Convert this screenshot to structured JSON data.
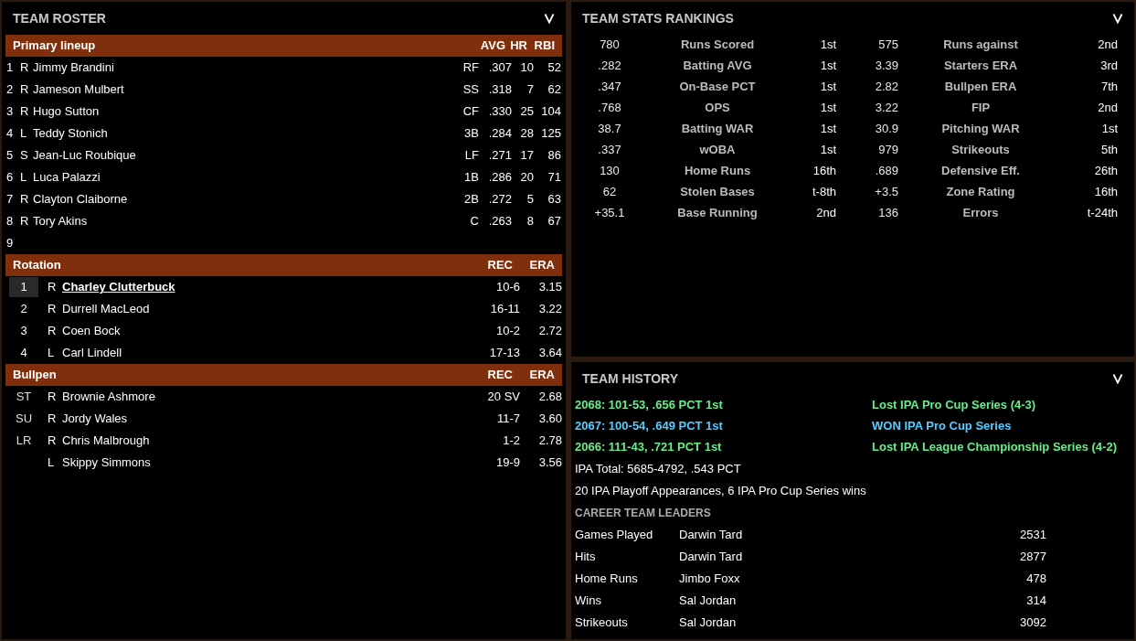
{
  "roster": {
    "title": "TEAM ROSTER",
    "lineup": {
      "heading": "Primary lineup",
      "columns": [
        "AVG",
        "HR",
        "RBI"
      ],
      "rows": [
        {
          "order": "1",
          "hand": "R",
          "name": "Jimmy Brandini",
          "pos": "RF",
          "avg": ".307",
          "hr": "10",
          "rbi": "52"
        },
        {
          "order": "2",
          "hand": "R",
          "name": "Jameson Mulbert",
          "pos": "SS",
          "avg": ".318",
          "hr": "7",
          "rbi": "62"
        },
        {
          "order": "3",
          "hand": "R",
          "name": "Hugo Sutton",
          "pos": "CF",
          "avg": ".330",
          "hr": "25",
          "rbi": "104"
        },
        {
          "order": "4",
          "hand": "L",
          "name": "Teddy Stonich",
          "pos": "3B",
          "avg": ".284",
          "hr": "28",
          "rbi": "125"
        },
        {
          "order": "5",
          "hand": "S",
          "name": "Jean-Luc Roubique",
          "pos": "LF",
          "avg": ".271",
          "hr": "17",
          "rbi": "86"
        },
        {
          "order": "6",
          "hand": "L",
          "name": "Luca Palazzi",
          "pos": "1B",
          "avg": ".286",
          "hr": "20",
          "rbi": "71"
        },
        {
          "order": "7",
          "hand": "R",
          "name": "Clayton Claiborne",
          "pos": "2B",
          "avg": ".272",
          "hr": "5",
          "rbi": "63"
        },
        {
          "order": "8",
          "hand": "R",
          "name": "Tory Akins",
          "pos": "C",
          "avg": ".263",
          "hr": "8",
          "rbi": "67"
        },
        {
          "order": "9"
        }
      ]
    },
    "rotation": {
      "heading": "Rotation",
      "columns": [
        "REC",
        "ERA"
      ],
      "rows": [
        {
          "slot": "1",
          "hand": "R",
          "name": "Charley Clutterbuck",
          "rec": "10-6",
          "era": "3.15",
          "selected": true
        },
        {
          "slot": "2",
          "hand": "R",
          "name": "Durrell MacLeod",
          "rec": "16-11",
          "era": "3.22",
          "selected": false
        },
        {
          "slot": "3",
          "hand": "R",
          "name": "Coen Bock",
          "rec": "10-2",
          "era": "2.72",
          "selected": false
        },
        {
          "slot": "4",
          "hand": "L",
          "name": "Carl Lindell",
          "rec": "17-13",
          "era": "3.64",
          "selected": false
        }
      ]
    },
    "bullpen": {
      "heading": "Bullpen",
      "columns": [
        "REC",
        "ERA"
      ],
      "rows": [
        {
          "slot": "ST",
          "hand": "R",
          "name": "Brownie Ashmore",
          "rec": "20 SV",
          "era": "2.68"
        },
        {
          "slot": "SU",
          "hand": "R",
          "name": "Jordy Wales",
          "rec": "11-7",
          "era": "3.60"
        },
        {
          "slot": "LR",
          "hand": "R",
          "name": "Chris Malbrough",
          "rec": "1-2",
          "era": "2.78"
        },
        {
          "hand": "L",
          "name": "Skippy Simmons",
          "rec": "19-9",
          "era": "3.56"
        }
      ]
    }
  },
  "rankings": {
    "title": "TEAM STATS RANKINGS",
    "rows": [
      {
        "batting": {
          "value": "780",
          "label": "Runs Scored",
          "rank": "1st"
        },
        "pitching": {
          "value": "575",
          "label": "Runs against",
          "rank": "2nd"
        }
      },
      {
        "batting": {
          "value": ".282",
          "label": "Batting AVG",
          "rank": "1st"
        },
        "pitching": {
          "value": "3.39",
          "label": "Starters ERA",
          "rank": "3rd"
        }
      },
      {
        "batting": {
          "value": ".347",
          "label": "On-Base PCT",
          "rank": "1st"
        },
        "pitching": {
          "value": "2.82",
          "label": "Bullpen ERA",
          "rank": "7th"
        }
      },
      {
        "batting": {
          "value": ".768",
          "label": "OPS",
          "rank": "1st"
        },
        "pitching": {
          "value": "3.22",
          "label": "FIP",
          "rank": "2nd"
        }
      },
      {
        "batting": {
          "value": "38.7",
          "label": "Batting WAR",
          "rank": "1st"
        },
        "pitching": {
          "value": "30.9",
          "label": "Pitching WAR",
          "rank": "1st"
        }
      },
      {
        "batting": {
          "value": ".337",
          "label": "wOBA",
          "rank": "1st"
        },
        "pitching": {
          "value": "979",
          "label": "Strikeouts",
          "rank": "5th"
        }
      },
      {
        "batting": {
          "value": "130",
          "label": "Home Runs",
          "rank": "16th"
        },
        "pitching": {
          "value": ".689",
          "label": "Defensive Eff.",
          "rank": "26th"
        }
      },
      {
        "batting": {
          "value": "62",
          "label": "Stolen Bases",
          "rank": "t-8th"
        },
        "pitching": {
          "value": "+3.5",
          "label": "Zone Rating",
          "rank": "16th"
        }
      },
      {
        "batting": {
          "value": "+35.1",
          "label": "Base Running",
          "rank": "2nd"
        },
        "pitching": {
          "value": "136",
          "label": "Errors",
          "rank": "t-24th"
        }
      }
    ]
  },
  "history": {
    "title": "TEAM HISTORY",
    "seasons": [
      {
        "record": "2068: 101-53, .656 PCT 1st",
        "result": "Lost IPA Pro Cup Series (4-3)",
        "color": "#66ee88"
      },
      {
        "record": "2067: 100-54, .649 PCT 1st",
        "result": "WON IPA Pro Cup Series",
        "color": "#55ccff"
      },
      {
        "record": "2066: 111-43, .721 PCT 1st",
        "result": "Lost IPA League Championship Series  (4-2)",
        "color": "#66ee88"
      }
    ],
    "total": "IPA Total: 5685-4792, .543 PCT",
    "playoffs": "20 IPA Playoff Appearances, 6 IPA Pro Cup Series wins",
    "leaders_title": "CAREER TEAM LEADERS",
    "leaders": [
      {
        "category": "Games Played",
        "player": "Darwin Tard",
        "value": "2531"
      },
      {
        "category": "Hits",
        "player": "Darwin Tard",
        "value": "2877"
      },
      {
        "category": "Home Runs",
        "player": "Jimbo Foxx",
        "value": "478"
      },
      {
        "category": "Wins",
        "player": "Sal Jordan",
        "value": "314"
      },
      {
        "category": "Strikeouts",
        "player": "Sal Jordan",
        "value": "3092"
      }
    ]
  }
}
